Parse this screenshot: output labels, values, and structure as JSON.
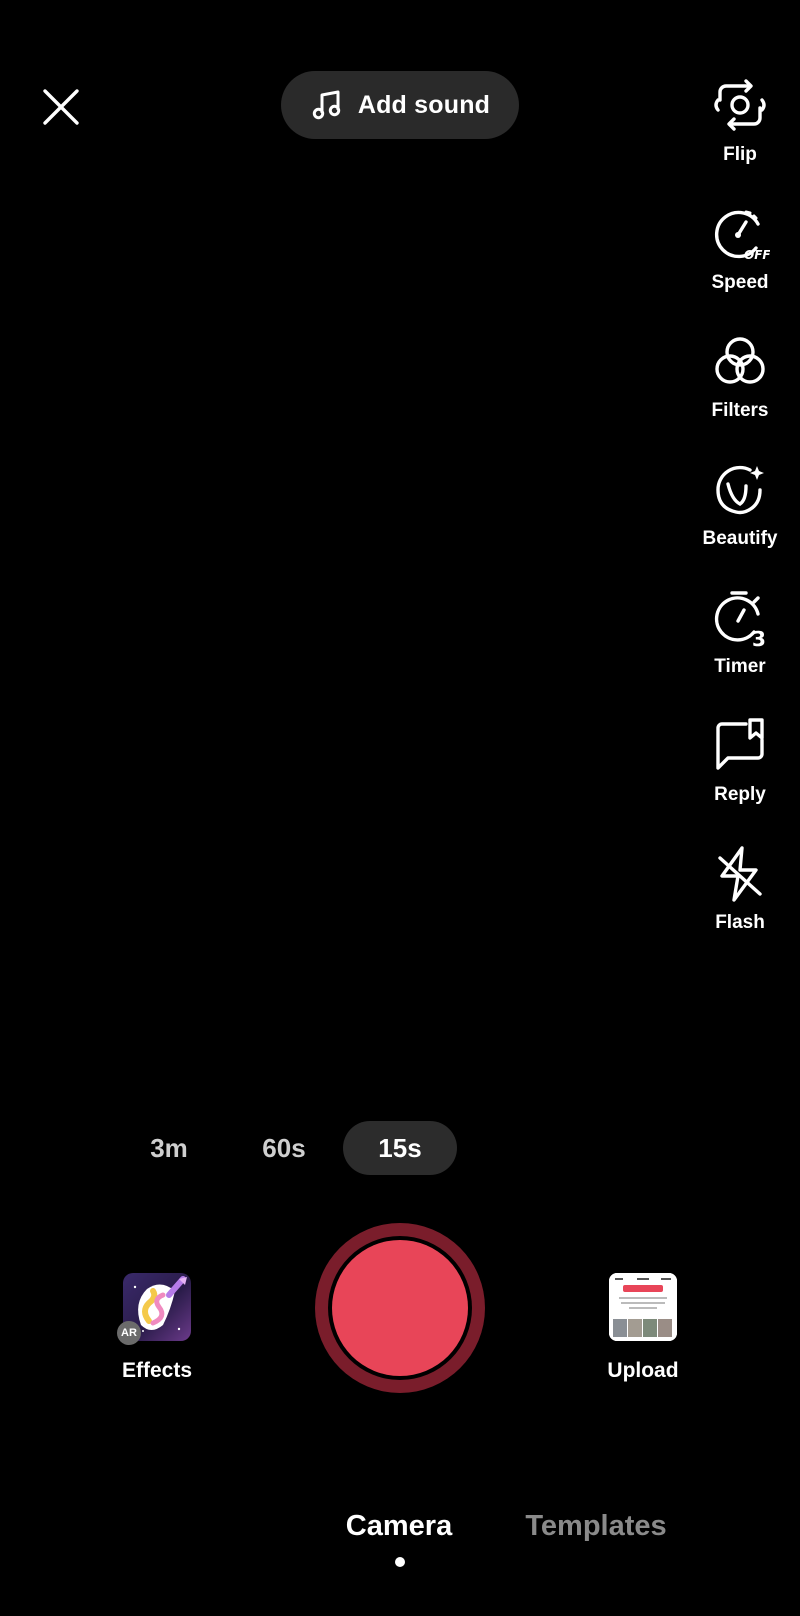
{
  "top": {
    "close_icon": "close-icon",
    "add_sound": {
      "icon": "music-note-icon",
      "label": "Add sound"
    }
  },
  "tools": [
    {
      "icon": "flip-camera-icon",
      "label": "Flip"
    },
    {
      "icon": "speed-icon",
      "label": "Speed",
      "icon_text": "OFF"
    },
    {
      "icon": "filters-icon",
      "label": "Filters"
    },
    {
      "icon": "beautify-icon",
      "label": "Beautify"
    },
    {
      "icon": "timer-icon",
      "label": "Timer",
      "icon_text": "3"
    },
    {
      "icon": "reply-icon",
      "label": "Reply"
    },
    {
      "icon": "flash-off-icon",
      "label": "Flash"
    }
  ],
  "durations": {
    "options": [
      "3m",
      "60s",
      "15s"
    ],
    "selected": "15s"
  },
  "record": {
    "icon": "record-button",
    "color": "#e84558",
    "ring_color": "#7a1d2b"
  },
  "effects": {
    "label": "Effects",
    "badge": "AR"
  },
  "upload": {
    "label": "Upload"
  },
  "tabs": {
    "items": [
      "Camera",
      "Templates"
    ],
    "active": "Camera"
  },
  "colors": {
    "background": "#000000",
    "pill_bg": "#2a2a2a",
    "inactive_tab": "#8a8a8a"
  }
}
